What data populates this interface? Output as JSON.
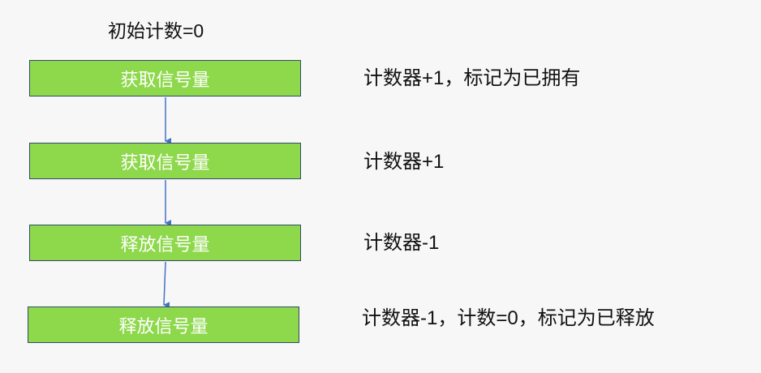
{
  "title": "初始计数=0",
  "steps": [
    {
      "label": "获取信号量",
      "note": "计数器+1，标记为已拥有"
    },
    {
      "label": "获取信号量",
      "note": "计数器+1"
    },
    {
      "label": "释放信号量",
      "note": "计数器-1"
    },
    {
      "label": "释放信号量",
      "note": "计数器-1，计数=0，标记为已释放"
    }
  ],
  "colors": {
    "box_fill": "#8ed84c",
    "box_border": "#2f4a6b",
    "arrow": "#4472c4"
  }
}
